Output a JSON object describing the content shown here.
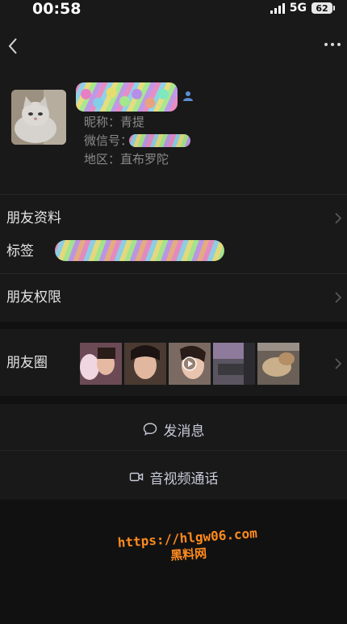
{
  "status_bar": {
    "time": "00:58",
    "network": "5G",
    "battery": "62"
  },
  "profile": {
    "nickname_label": "昵称：青提",
    "wechat_id_label": "微信号：",
    "region_label": "地区：直布罗陀"
  },
  "rows": {
    "friend_info": "朋友资料",
    "tags": "标签",
    "permissions": "朋友权限",
    "moments": "朋友圈"
  },
  "actions": {
    "send_message": "发消息",
    "av_call": "音视频通话"
  },
  "watermark": {
    "url": "https://hlgw06.com",
    "name": "黑料网"
  }
}
